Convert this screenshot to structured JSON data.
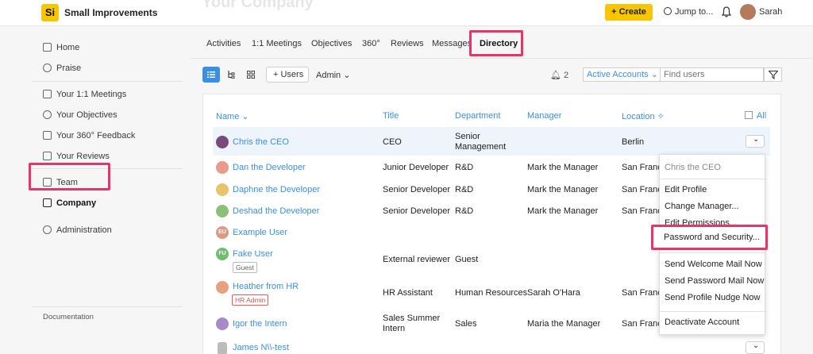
{
  "topbar": {
    "logo": "Si",
    "app_name": "Small Improvements",
    "ghost_title": "Your Company",
    "create_label": "+ Create",
    "jump_label": "Jump to...",
    "user_name": "Sarah"
  },
  "sidebar": {
    "items": [
      {
        "label": "Home",
        "icon": "home-icon"
      },
      {
        "label": "Praise",
        "icon": "praise-icon"
      },
      {
        "label": "Your 1:1 Meetings",
        "icon": "meetings-icon"
      },
      {
        "label": "Your Objectives",
        "icon": "target-icon"
      },
      {
        "label": "Your 360° Feedback",
        "icon": "feedback-icon"
      },
      {
        "label": "Your Reviews",
        "icon": "reviews-icon"
      },
      {
        "label": "Team",
        "icon": "team-icon"
      },
      {
        "label": "Company",
        "icon": "company-icon"
      },
      {
        "label": "Administration",
        "icon": "gear-icon"
      }
    ],
    "documentation": "Documentation"
  },
  "tabs": [
    "Activities",
    "1:1 Meetings",
    "Objectives",
    "360°",
    "Reviews",
    "Messages",
    "Directory"
  ],
  "toolbar": {
    "users_label": "+ Users",
    "admin_label": "Admin",
    "notif_count": "2",
    "accounts_select": "Active Accounts",
    "find_placeholder": "Find users"
  },
  "table": {
    "headers": {
      "name": "Name",
      "title": "Title",
      "department": "Department",
      "manager": "Manager",
      "location": "Location",
      "all": "All"
    },
    "rows": [
      {
        "name": "Chris the CEO",
        "title": "CEO",
        "department": "Senior Management",
        "manager": "",
        "location": "Berlin"
      },
      {
        "name": "Dan the Developer",
        "title": "Junior Developer",
        "department": "R&D",
        "manager": "Mark the Manager",
        "location": "San Franc"
      },
      {
        "name": "Daphne the Developer",
        "title": "Senior Developer",
        "department": "R&D",
        "manager": "Mark the Manager",
        "location": "San Franc"
      },
      {
        "name": "Deshad the Developer",
        "title": "Senior Developer",
        "department": "R&D",
        "manager": "Mark the Manager",
        "location": "San Franc"
      },
      {
        "name": "Example User",
        "initials": "EU",
        "title": "",
        "department": "",
        "manager": "",
        "location": ""
      },
      {
        "name": "Fake User",
        "initials": "FU",
        "badge": "Guest",
        "title": "External reviewer",
        "department": "Guest",
        "manager": "",
        "location": ""
      },
      {
        "name": "Heather from HR",
        "badge": "HR Admin",
        "title": "HR Assistant",
        "department": "Human Resources",
        "manager": "Sarah O'Hara",
        "location": "San Franc"
      },
      {
        "name": "Igor the Intern",
        "title": "Sales Summer Intern",
        "department": "Sales",
        "manager": "Maria the Manager",
        "location": "San Franc"
      },
      {
        "name": "James N\\\\-test",
        "title": "",
        "department": "",
        "manager": "",
        "location": ""
      }
    ]
  },
  "menu": {
    "header": "Chris the CEO",
    "items": [
      "Edit Profile",
      "Change Manager...",
      "Edit Permissions...",
      "Password and Security...",
      "Send Welcome Mail Now",
      "Send Password Mail Now",
      "Send Profile Nudge Now",
      "Deactivate Account"
    ]
  },
  "colors": {
    "accent": "#3a8fe3",
    "brand": "#f7c600",
    "highlight": "#e8336b"
  }
}
